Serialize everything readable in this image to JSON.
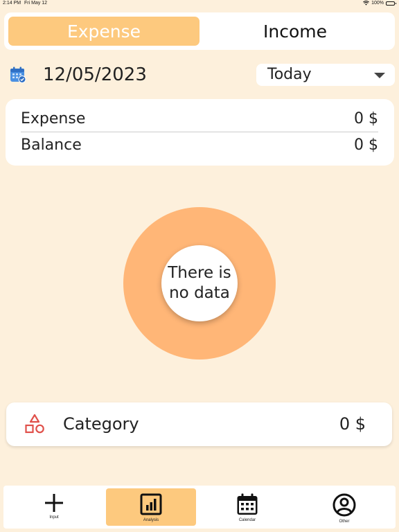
{
  "status": {
    "time": "2:14 PM",
    "date": "Fri May 12",
    "battery": "100%"
  },
  "segment": {
    "expense_label": "Expense",
    "income_label": "Income",
    "selected": "Expense"
  },
  "date_row": {
    "date": "12/05/2023",
    "period": "Today",
    "icon": "calendar-icon"
  },
  "summary": {
    "rows": [
      {
        "label": "Expense",
        "value": "0 $"
      },
      {
        "label": "Balance",
        "value": "0 $"
      }
    ]
  },
  "chart": {
    "empty_text": "There is no data"
  },
  "category": {
    "label": "Category",
    "value": "0 $",
    "icon": "shapes-icon"
  },
  "tabbar": {
    "items": [
      {
        "label": "Input",
        "icon": "plus-icon"
      },
      {
        "label": "Analysis",
        "icon": "bar-chart-icon"
      },
      {
        "label": "Calendar",
        "icon": "calendar-icon"
      },
      {
        "label": "Other",
        "icon": "user-circle-icon"
      }
    ],
    "active": "Analysis"
  },
  "colors": {
    "background": "#fdf0dc",
    "accent": "#fdc97e",
    "donut": "#ffb677",
    "category_icon": "#e0504a",
    "calendar_icon": "#4a90e2"
  }
}
